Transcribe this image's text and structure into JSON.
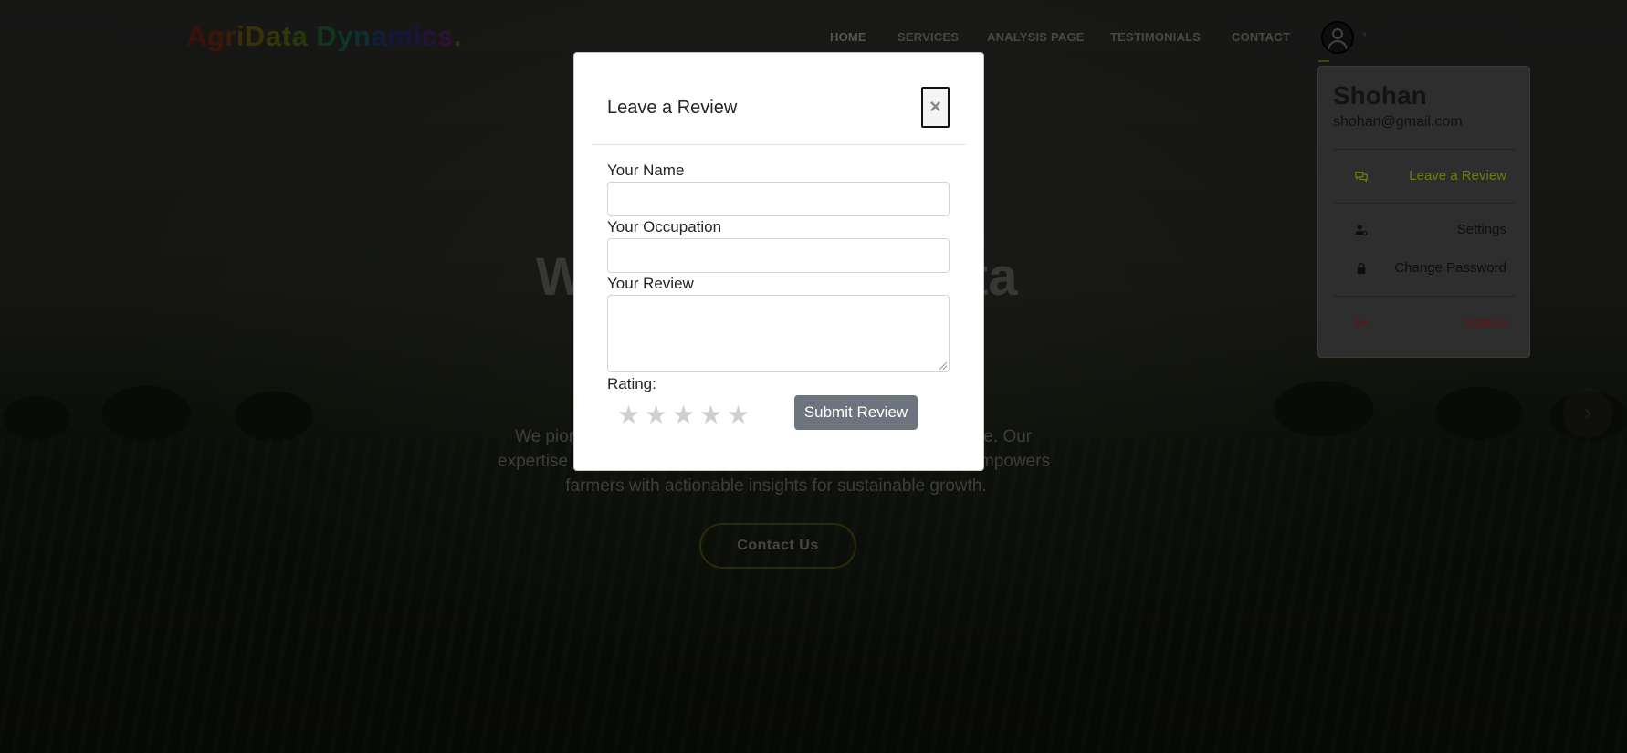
{
  "brand": {
    "logo_letters": [
      {
        "ch": "A",
        "color": "#7a1e14"
      },
      {
        "ch": "g",
        "color": "#7a2a10"
      },
      {
        "ch": "r",
        "color": "#7a3a10"
      },
      {
        "ch": "i",
        "color": "#7a5410"
      },
      {
        "ch": "D",
        "color": "#75630e"
      },
      {
        "ch": "a",
        "color": "#6a6d10"
      },
      {
        "ch": "t",
        "color": "#5d7012"
      },
      {
        "ch": "a",
        "color": "#4a7014"
      },
      {
        "ch": " ",
        "color": "#000"
      },
      {
        "ch": "D",
        "color": "#246d34"
      },
      {
        "ch": "y",
        "color": "#1a6a55"
      },
      {
        "ch": "n",
        "color": "#1a5a6e"
      },
      {
        "ch": "a",
        "color": "#1e3e7a"
      },
      {
        "ch": "m",
        "color": "#2a2a80"
      },
      {
        "ch": "i",
        "color": "#3a2580"
      },
      {
        "ch": "c",
        "color": "#4e207a"
      },
      {
        "ch": "s",
        "color": "#62206e"
      },
      {
        "ch": ".",
        "color": "#6a6a10"
      }
    ]
  },
  "nav": {
    "items": [
      {
        "label": "HOME",
        "active": true
      },
      {
        "label": "SERVICES",
        "active": false
      },
      {
        "label": "ANALYSIS PAGE",
        "active": false
      },
      {
        "label": "TESTIMONIALS",
        "active": false
      },
      {
        "label": "CONTACT",
        "active": false
      }
    ]
  },
  "hero": {
    "title_left": "W",
    "title_right": "ta",
    "paragraph": {
      "line1_left": "We pior",
      "line1_right": "re. Our",
      "line2_left": "expertise",
      "line2_right": "mpowers",
      "line3": "farmers with actionable insights for sustainable growth."
    },
    "contact_button": "Contact Us",
    "next_arrow": "›"
  },
  "profile_menu": {
    "name": "Shohan",
    "email": "shohan@gmail.com",
    "items": [
      {
        "label": "Leave a Review",
        "icon": "comments-icon",
        "color": "#6e7a12"
      },
      {
        "label": "Settings",
        "icon": "user-gear-icon",
        "color": "#0d0d0d"
      },
      {
        "label": "Change Password",
        "icon": "lock-icon",
        "color": "#0d0d0d"
      },
      {
        "label": "Logout",
        "icon": "sign-out-icon",
        "color": "#6a1010"
      }
    ]
  },
  "modal": {
    "title": "Leave a Review",
    "close_label": "×",
    "fields": {
      "name_label": "Your Name",
      "name_value": "",
      "occupation_label": "Your Occupation",
      "occupation_value": "",
      "review_label": "Your Review",
      "review_value": ""
    },
    "rating_label": "Rating:",
    "rating_value": 0,
    "rating_max": 5,
    "star_glyph": "★",
    "submit_label": "Submit Review"
  }
}
